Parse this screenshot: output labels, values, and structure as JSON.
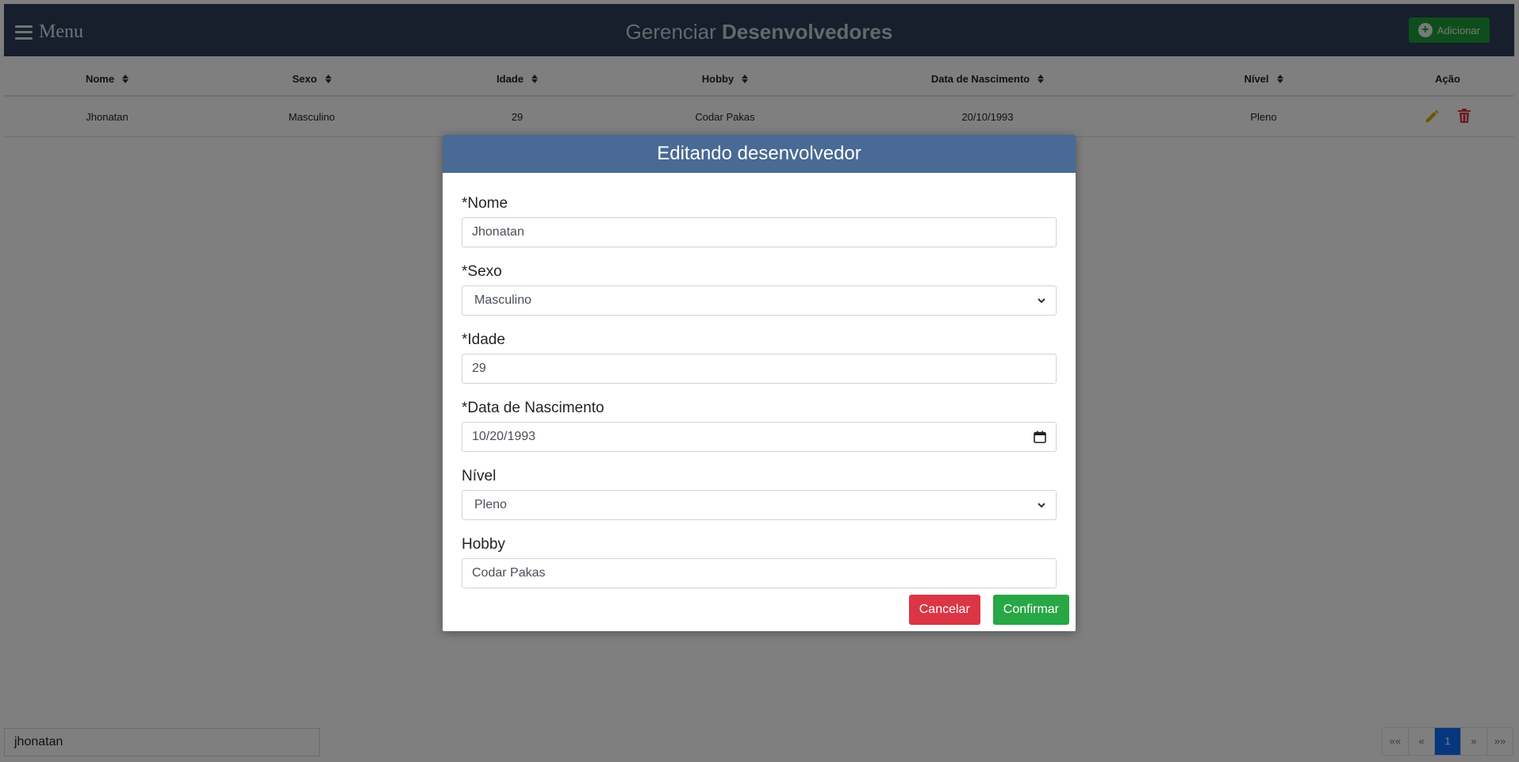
{
  "header": {
    "menu_label": "Menu",
    "title_prefix": "Gerenciar",
    "title_bold": "Desenvolvedores",
    "add_button": "Adicionar"
  },
  "table": {
    "columns": [
      "Nome",
      "Sexo",
      "Idade",
      "Hobby",
      "Data de Nascimento",
      "Nível",
      "Ação"
    ],
    "rows": [
      {
        "nome": "Jhonatan",
        "sexo": "Masculino",
        "idade": "29",
        "hobby": "Codar Pakas",
        "nascimento": "20/10/1993",
        "nivel": "Pleno"
      }
    ]
  },
  "search": {
    "value": "jhonatan"
  },
  "pagination": {
    "first": "««",
    "prev": "«",
    "current": "1",
    "next": "»",
    "last": "»»"
  },
  "modal": {
    "title": "Editando desenvolvedor",
    "fields": {
      "nome": {
        "label": "*Nome",
        "value": "Jhonatan"
      },
      "sexo": {
        "label": "*Sexo",
        "value": "Masculino"
      },
      "idade": {
        "label": "*Idade",
        "value": "29"
      },
      "nascimento": {
        "label": "*Data de Nascimento",
        "value": "10/20/1993"
      },
      "nivel": {
        "label": "Nível",
        "value": "Pleno"
      },
      "hobby": {
        "label": "Hobby",
        "value": "Codar Pakas"
      }
    },
    "cancel": "Cancelar",
    "confirm": "Confirmar"
  },
  "colors": {
    "header_bg": "#2c3e57",
    "modal_header_bg": "#486a94",
    "add_button": "#1f9a3a",
    "cancel": "#dc3545",
    "confirm": "#28a745",
    "pencil_icon": "#e0a800",
    "trash_icon": "#dc3545",
    "page_active": "#0d6efd"
  }
}
